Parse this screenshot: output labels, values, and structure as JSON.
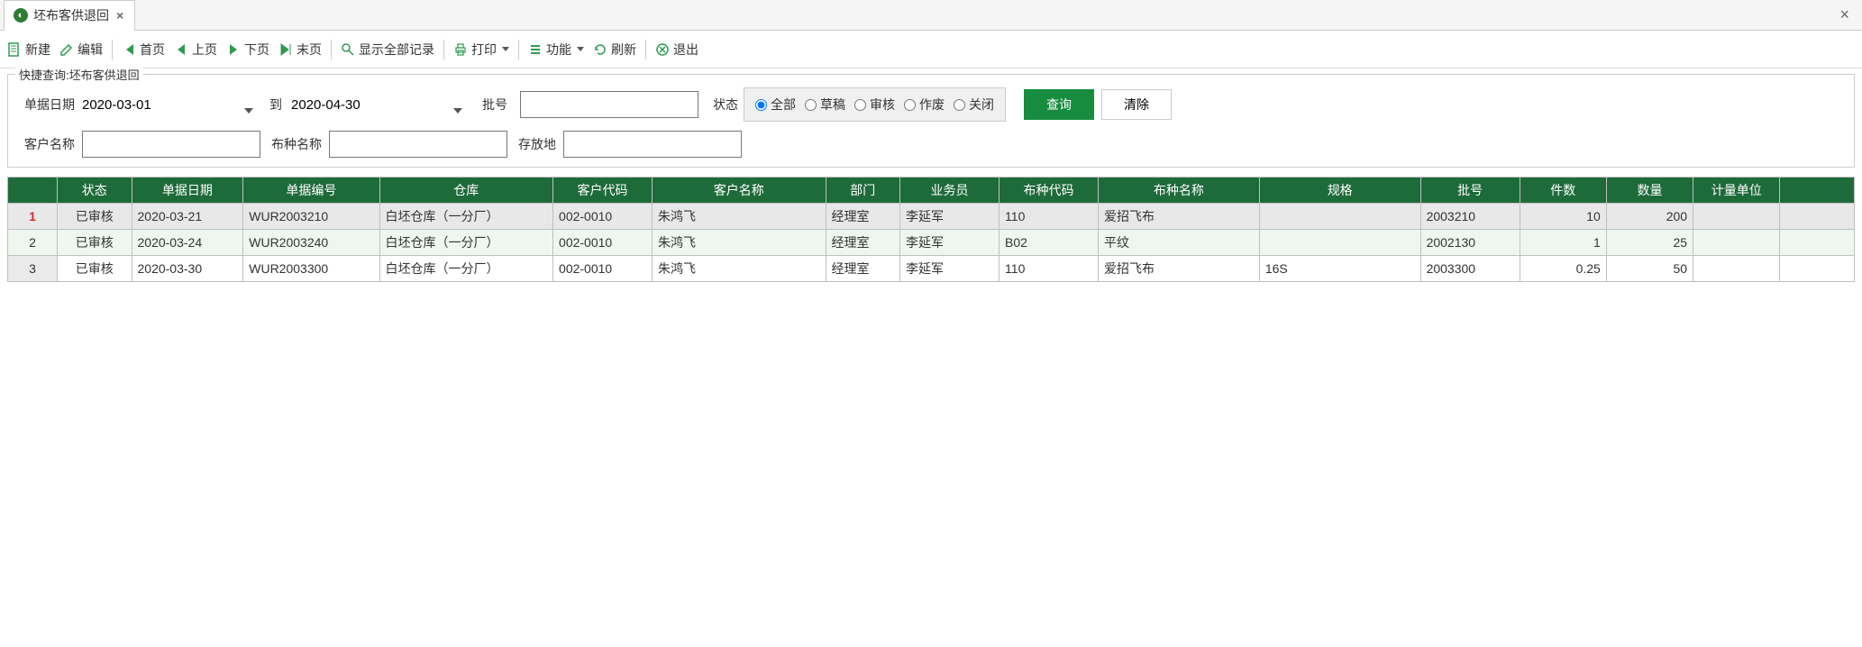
{
  "tab": {
    "title": "坯布客供退回"
  },
  "toolbar": {
    "new": "新建",
    "edit": "编辑",
    "first": "首页",
    "prev": "上页",
    "next": "下页",
    "last": "末页",
    "show_all": "显示全部记录",
    "print": "打印",
    "func": "功能",
    "refresh": "刷新",
    "exit": "退出"
  },
  "query": {
    "legend": "快捷查询:坯布客供退回",
    "date_label": "单据日期",
    "date_from": "2020-03-01",
    "to": "到",
    "date_to": "2020-04-30",
    "batch_label": "批号",
    "batch": "",
    "status_label": "状态",
    "cust_label": "客户名称",
    "cust": "",
    "fabric_label": "布种名称",
    "fabric": "",
    "location_label": "存放地",
    "location": "",
    "status_options": {
      "all": "全部",
      "draft": "草稿",
      "audit": "审核",
      "void": "作废",
      "closed": "关闭"
    },
    "search_btn": "查询",
    "clear_btn": "清除"
  },
  "grid": {
    "headers": {
      "status": "状态",
      "doc_date": "单据日期",
      "doc_no": "单据编号",
      "warehouse": "仓库",
      "cust_code": "客户代码",
      "cust_name": "客户名称",
      "dept": "部门",
      "sales": "业务员",
      "fabric_code": "布种代码",
      "fabric_name": "布种名称",
      "spec": "规格",
      "batch": "批号",
      "pcs": "件数",
      "qty": "数量",
      "unit": "计量单位"
    },
    "rows": [
      {
        "status": "已审核",
        "doc_date": "2020-03-21",
        "doc_no": "WUR2003210",
        "warehouse": "白坯仓库（一分厂）",
        "cust_code": "002-0010",
        "cust_name": "朱鸿飞",
        "dept": "经理室",
        "sales": "李延军",
        "fabric_code": "110",
        "fabric_name": "爱招飞布",
        "spec": "",
        "batch": "2003210",
        "pcs": "10",
        "qty": "200",
        "unit": ""
      },
      {
        "status": "已审核",
        "doc_date": "2020-03-24",
        "doc_no": "WUR2003240",
        "warehouse": "白坯仓库（一分厂）",
        "cust_code": "002-0010",
        "cust_name": "朱鸿飞",
        "dept": "经理室",
        "sales": "李延军",
        "fabric_code": "B02",
        "fabric_name": "平纹",
        "spec": "",
        "batch": "2002130",
        "pcs": "1",
        "qty": "25",
        "unit": ""
      },
      {
        "status": "已审核",
        "doc_date": "2020-03-30",
        "doc_no": "WUR2003300",
        "warehouse": "白坯仓库（一分厂）",
        "cust_code": "002-0010",
        "cust_name": "朱鸿飞",
        "dept": "经理室",
        "sales": "李延军",
        "fabric_code": "110",
        "fabric_name": "爱招飞布",
        "spec": "16S",
        "batch": "2003300",
        "pcs": "0.25",
        "qty": "50",
        "unit": ""
      }
    ]
  }
}
